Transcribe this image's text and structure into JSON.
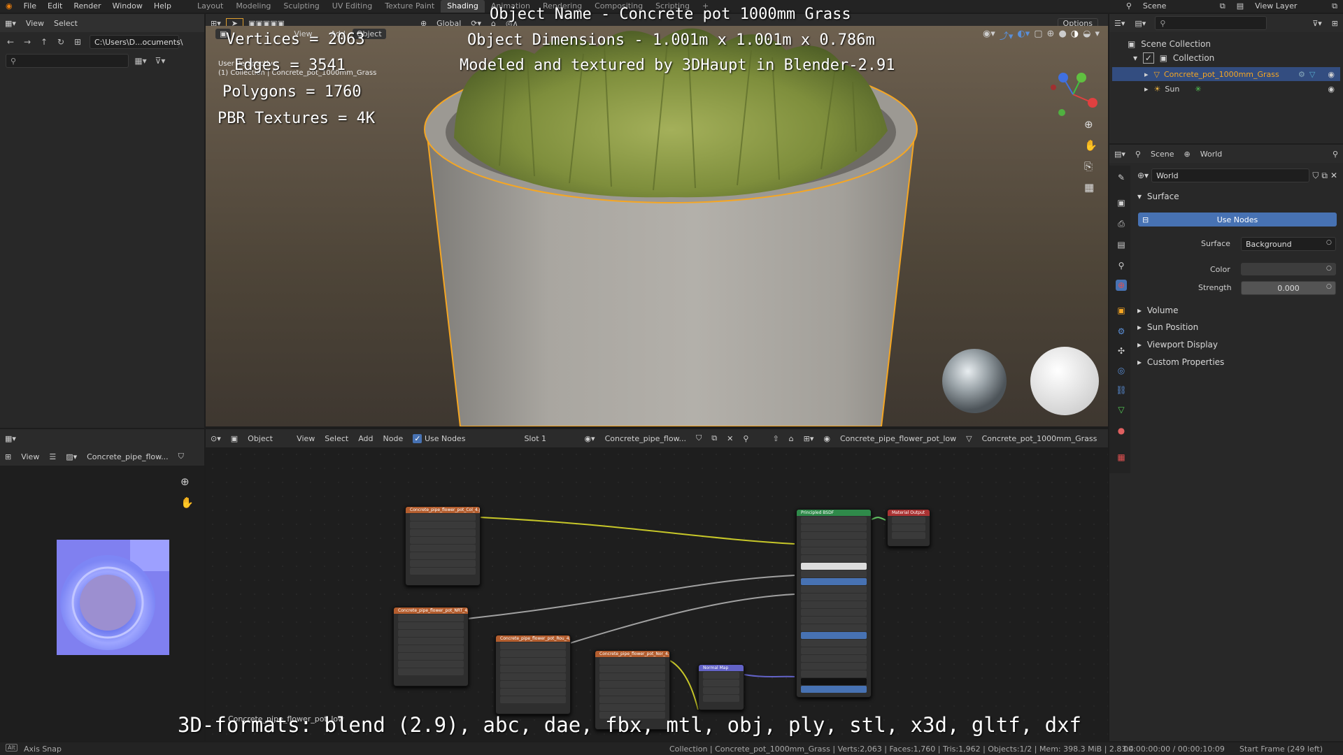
{
  "topbar": {
    "menus": [
      "File",
      "Edit",
      "Render",
      "Window",
      "Help"
    ],
    "workspaces": [
      "Layout",
      "Modeling",
      "Sculpting",
      "UV Editing",
      "Texture Paint",
      "Shading",
      "Animation",
      "Rendering",
      "Compositing",
      "Scripting"
    ],
    "active_workspace": "Shading",
    "scene_label": "Scene",
    "view_layer_label": "View Layer"
  },
  "file_browser": {
    "menus": [
      "View",
      "Select"
    ],
    "path": "C:\\Users\\D...ocuments\\"
  },
  "viewport": {
    "header": {
      "transform": "Global",
      "options": "Options",
      "view_menu": "View",
      "add_menu": "Add",
      "object_menu": "Object"
    },
    "info_line1": "User Perspective",
    "info_line2": "(1) Collection | Concrete_pot_1000mm_Grass",
    "overlay": {
      "name": "Object Name - Concrete pot 1000mm Grass",
      "dimensions": "Object Dimensions -  1.001m x 1.001m x 0.786m",
      "credit": "Modeled and textured by 3DHaupt in Blender-2.91",
      "vertices": "Vertices = 2063",
      "edges": "Edges = 3541",
      "polygons": "Polygons = 1760",
      "textures": "PBR Textures = 4K",
      "formats": "3D-formats: blend (2.9), abc, dae, fbx, mtl, obj, ply, stl, x3d, gltf, dxf"
    }
  },
  "outliner": {
    "scene_collection": "Scene Collection",
    "collection": "Collection",
    "object": "Concrete_pot_1000mm_Grass",
    "sun": "Sun"
  },
  "properties": {
    "scene_tab": "Scene",
    "world_tab": "World",
    "world_name": "World",
    "surface_section": "Surface",
    "use_nodes": "Use Nodes",
    "surface_label": "Surface",
    "surface_value": "Background",
    "color_label": "Color",
    "strength_label": "Strength",
    "strength_value": "0.000",
    "sections": [
      "Volume",
      "Sun Position",
      "Viewport Display",
      "Custom Properties"
    ]
  },
  "image_editor": {
    "view_menu": "View",
    "image_name": "Concrete_pipe_flow..."
  },
  "node_editor": {
    "mode": "Object",
    "menus": [
      "View",
      "Select",
      "Add",
      "Node"
    ],
    "use_nodes": "Use Nodes",
    "slot": "Slot 1",
    "material": "Concrete_pipe_flow...",
    "breadcrumb_material": "Concrete_pipe_flower_pot_low",
    "breadcrumb_object": "Concrete_pot_1000mm_Grass",
    "frame_label": "Concrete_pipe_flower_pot_low",
    "nodes": [
      {
        "title": "Concrete_pipe_flower_pot_Col_4.jpg"
      },
      {
        "title": "Concrete_pipe_flower_pot_NRT_4.jpg"
      },
      {
        "title": "Concrete_pipe_flower_pot_Rou_4.jpg"
      },
      {
        "title": "Concrete_pipe_flower_pot_Nor_4.jpg"
      },
      {
        "title": "Normal Map"
      },
      {
        "title": "Principled BSDF"
      },
      {
        "title": "Material Output"
      }
    ]
  },
  "statusbar": {
    "left": "Axis Snap",
    "stats": "Collection | Concrete_pot_1000mm_Grass | Verts:2,063 | Faces:1,760 | Tris:1,962 | Objects:1/2 | Mem: 398.3 MiB | 2.83.4",
    "time": "00:00:00:00 / 00:00:10:09",
    "frame": "Start Frame (249 left)"
  },
  "colors": {
    "accent_blue": "#4772b3",
    "selection_orange": "#f5a623",
    "texture_node_header": "#b35d2e",
    "shader_node_header": "#2f8a4a",
    "output_node_header": "#a33"
  }
}
